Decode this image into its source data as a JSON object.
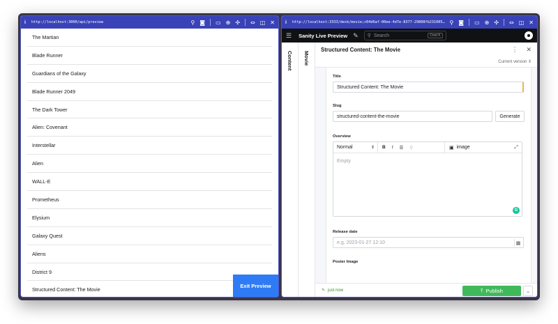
{
  "left": {
    "url": "http://localhost:3000/api/preview",
    "info_icon": "i",
    "movies": [
      "The Martian",
      "Blade Runner",
      "Guardians of the Galaxy",
      "Blade Runner 2049",
      "The Dark Tower",
      "Alien: Covenant",
      "Interstellar",
      "Alien",
      "WALL-E",
      "Prometheus",
      "Elysium",
      "Galaxy Quest",
      "Aliens",
      "District 9",
      "Structured Content: The Movie"
    ],
    "exit_label": "Exit Preview"
  },
  "right": {
    "url": "http://localhost:3333/desk/movie;c04d6af-00ee-4d7e-8377-29808fb2310052ctem…",
    "info_icon": "i",
    "studio_title": "Sanity Live Preview",
    "search_placeholder": "Search",
    "search_kbd": "Cmd K",
    "pane_content": "Content",
    "pane_movie": "Movie",
    "doc_title": "Structured Content: The Movie",
    "version": "Current version",
    "fields": {
      "title_label": "Title",
      "title_value": "Structured Content: The Movie",
      "slug_label": "Slug",
      "slug_value": "structured-content-the-movie",
      "generate": "Generate",
      "overview_label": "Overview",
      "style": "Normal",
      "image": "image",
      "empty": "Empty",
      "release_label": "Release date",
      "release_placeholder": "e.g. 2023-01-27 12:10",
      "poster_label": "Poster Image"
    },
    "status": "just now",
    "publish": "Publish"
  }
}
